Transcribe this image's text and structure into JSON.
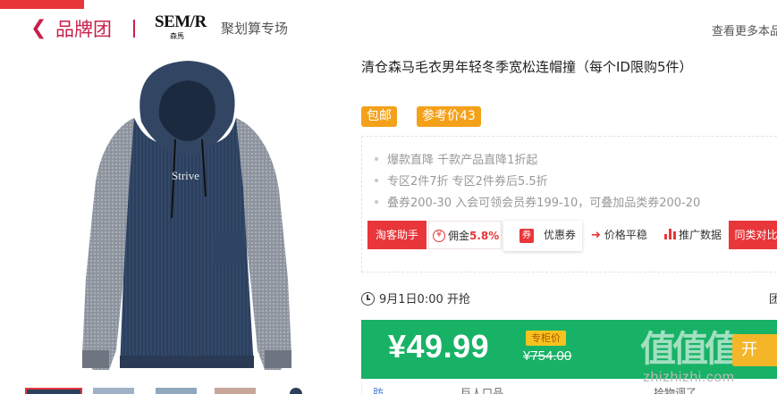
{
  "header": {
    "back_icon": "chevron-left-icon",
    "title": "品牌团",
    "brand_logo_main": "SEM/R",
    "brand_logo_sub": "森馬",
    "subtitle": "聚划算专场",
    "view_more": "查看更多本品"
  },
  "product": {
    "title": "清仓森马毛衣男年轻冬季宽松连帽撞（每个ID限购5件）",
    "image_text": "Strive",
    "tags": [
      "包邮",
      "参考价43"
    ]
  },
  "promo": {
    "lines": [
      "爆款直降 千款产品直降1折起",
      "专区2件7折 专区2件券后5.5折",
      "叠券200-30 入会可领会员券199-10，可叠加品类券200-20"
    ],
    "tools": {
      "assistant": "淘客助手",
      "commission_label": "佣金",
      "commission_value": "5.8%",
      "coupon_icon_text": "券",
      "coupon": "优惠券",
      "price_trend": "价格平稳",
      "promo_data": "推广数据",
      "compare": "同类对比"
    }
  },
  "countdown": {
    "text": "9月1日0:00 开抢",
    "right_edge": "团"
  },
  "price": {
    "current": "¥49.99",
    "counter_label": "专柜价",
    "original": "¥754.00",
    "buy_label": "开",
    "watermark": "值值值",
    "watermark_url": "zhizhizhi.com"
  },
  "bottom": {
    "items": [
      "肪",
      "巨人口品",
      "拾物调了"
    ]
  },
  "colors": {
    "brand_red": "#c71f4a",
    "accent_red": "#e8363a",
    "tag_orange": "#f4a11a",
    "price_green": "#18b266"
  }
}
